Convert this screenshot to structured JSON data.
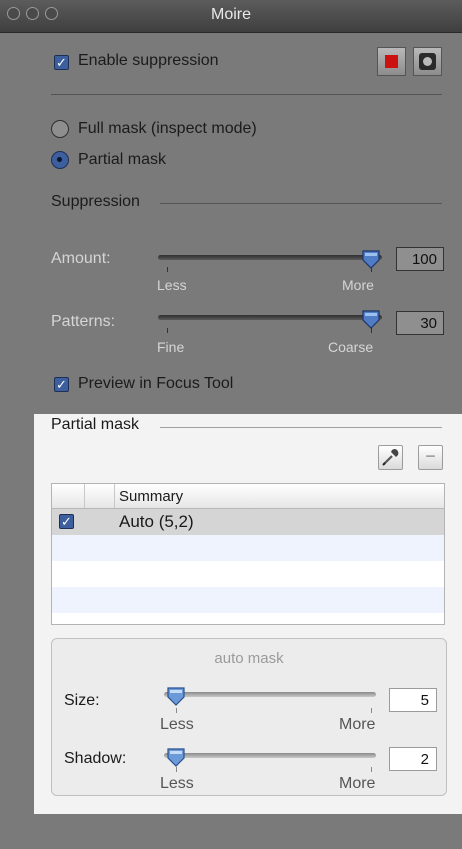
{
  "window": {
    "title": "Moire"
  },
  "top": {
    "enable_label": "Enable suppression",
    "enable_checked": true
  },
  "mode": {
    "full_label": "Full mask (inspect mode)",
    "partial_label": "Partial mask",
    "selected": "partial"
  },
  "suppression": {
    "heading": "Suppression",
    "amount": {
      "label": "Amount:",
      "value": "100",
      "min_label": "Less",
      "max_label": "More",
      "level": 1.0
    },
    "patterns": {
      "label": "Patterns:",
      "value": "30",
      "min_label": "Fine",
      "max_label": "Coarse",
      "level": 1.0
    },
    "preview_label": "Preview in Focus Tool",
    "preview_checked": true
  },
  "partial_mask": {
    "heading": "Partial mask",
    "remove_label": "−",
    "table": {
      "column_header": "Summary",
      "rows": [
        {
          "checked": true,
          "summary": "Auto (5,2)"
        }
      ]
    },
    "auto_mask": {
      "title": "auto mask",
      "size": {
        "label": "Size:",
        "value": "5",
        "min_label": "Less",
        "max_label": "More",
        "level": 0.0
      },
      "shadow": {
        "label": "Shadow:",
        "value": "2",
        "min_label": "Less",
        "max_label": "More",
        "level": 0.0
      }
    }
  },
  "colors": {
    "accent": "#3d5f9e",
    "stop_red": "#cc1111"
  }
}
